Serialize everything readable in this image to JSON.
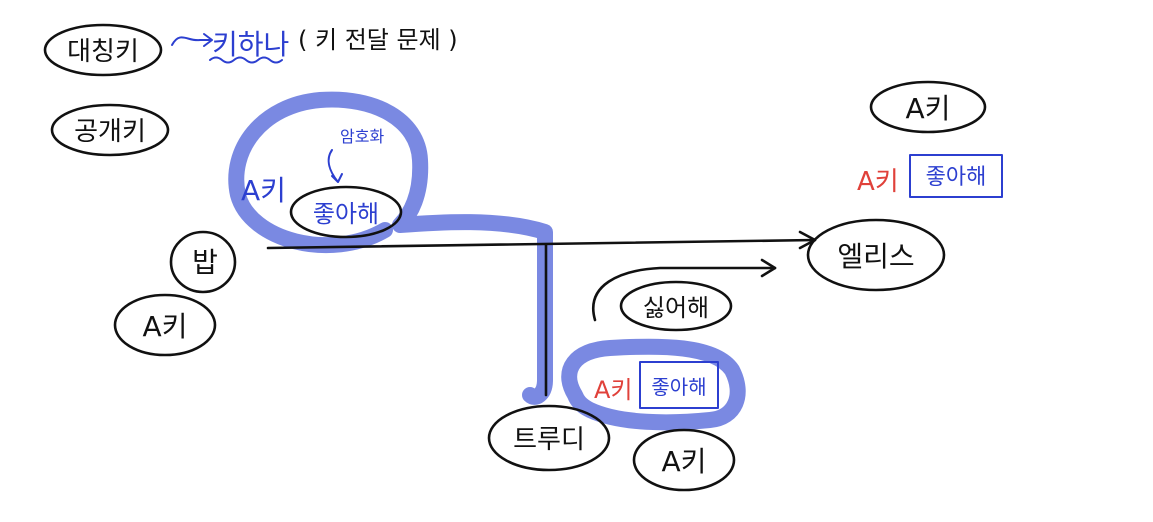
{
  "legend": {
    "symmetric_key": "대칭키",
    "single_key": "키하나",
    "single_key_note": "( 키 전달 문제 )",
    "public_key": "공개키"
  },
  "nodes": {
    "bob": "밥",
    "bob_key": "A키",
    "alice": "엘리스",
    "alice_key": "A키",
    "trudy": "트루디",
    "trudy_key": "A키"
  },
  "messages": {
    "bob_msg_key": "A키",
    "bob_msg_text": "좋아해",
    "encrypt_label": "암호화",
    "alice_msg_key": "A키",
    "alice_msg_text": "좋아해",
    "trudy_msg_key": "A키",
    "trudy_msg_text": "좋아해",
    "fake_msg": "싫어해"
  },
  "colors": {
    "ink": "#111111",
    "blue_ink": "#2c3fd0",
    "red_ink": "#e0413a",
    "highlight": "#6f7fe0"
  }
}
